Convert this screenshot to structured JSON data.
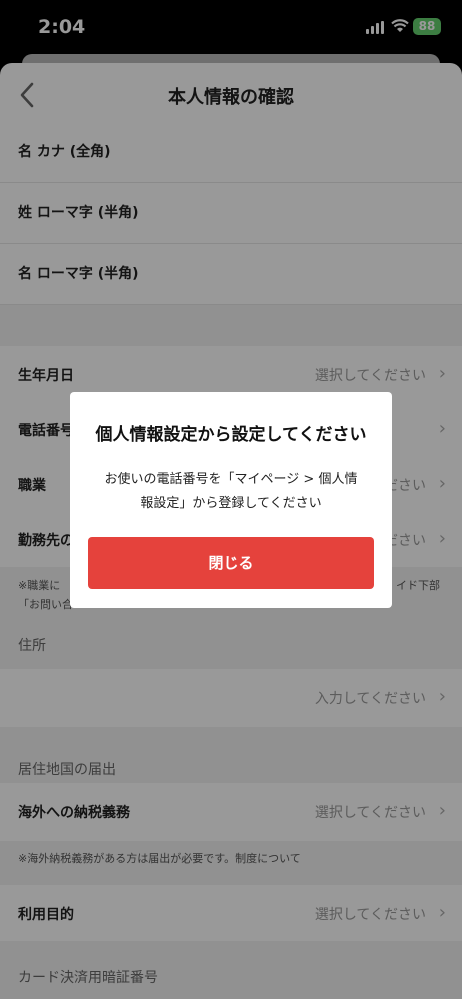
{
  "status": {
    "time": "2:04",
    "battery": "88"
  },
  "nav": {
    "title": "本人情報の確認"
  },
  "fields": {
    "mei_kana": "名 カナ (全角)",
    "sei_romaji": "姓 ローマ字 (半角)",
    "mei_romaji": "名 ローマ字 (半角)",
    "birthday": {
      "label": "生年月日",
      "value": "選択してください"
    },
    "phone": {
      "label": "電話番号"
    },
    "occupation": {
      "label": "職業",
      "value": "選択してください"
    },
    "workplace": {
      "label": "勤務先の",
      "value": "選択してください"
    },
    "occupation_note_1_left": "※職業に",
    "occupation_note_1_right": "イド下部",
    "occupation_note_2": "「お問い合",
    "address_section": "住所",
    "address": {
      "value": "入力してください"
    },
    "residence_section": "居住地国の届出",
    "overseas_tax": {
      "label": "海外への納税義務",
      "value": "選択してください"
    },
    "overseas_note": "※海外納税義務がある方は届出が必要です。制度について",
    "purpose": {
      "label": "利用目的",
      "value": "選択してください"
    },
    "pin_section": "カード決済用暗証番号"
  },
  "dialog": {
    "title": "個人情報設定から設定してください",
    "message_line1": "お使いの電話番号を「マイページ > 個人情",
    "message_line2": "報設定」から登録してください",
    "close_label": "閉じる"
  },
  "colors": {
    "accent": "#e5423c",
    "battery": "#65d16f"
  }
}
